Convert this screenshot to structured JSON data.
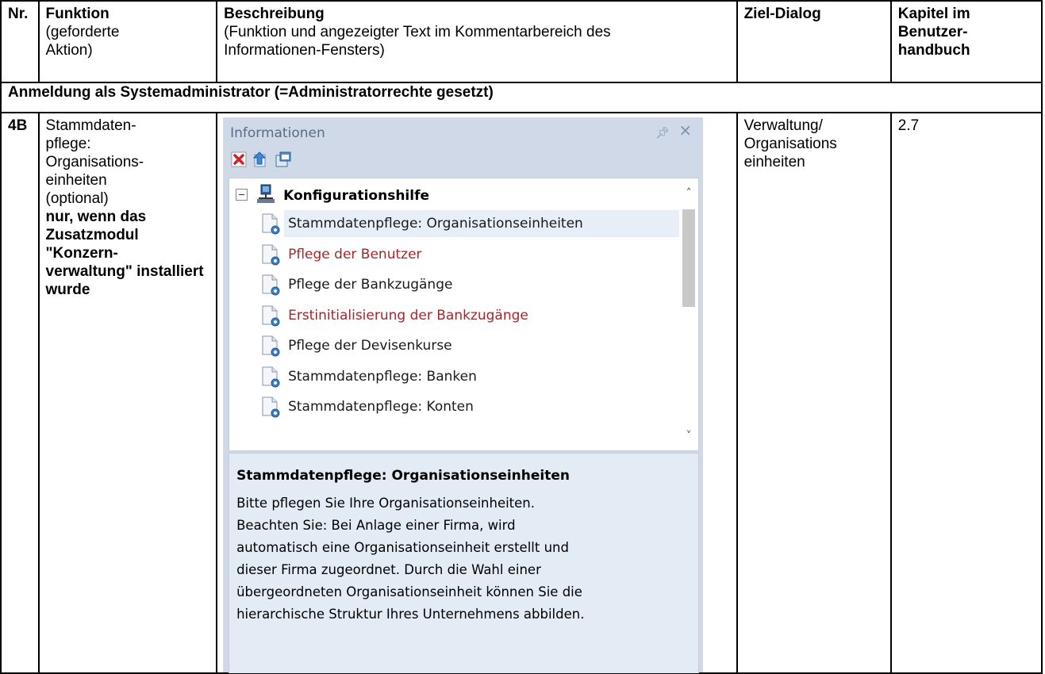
{
  "header": {
    "nr": "Nr.",
    "funktion_title": "Funktion",
    "funktion_sub": "(geforderte Aktion)",
    "beschreibung_title": "Beschreibung",
    "beschreibung_sub": "(Funktion und angezeigter Text im Kommentarbereich des Informationen-Fensters)",
    "ziel": "Ziel-Dialog",
    "kapitel": "Kapitel im Benutzer-handbuch"
  },
  "section": "Anmeldung als Systemadministrator (=Administratorrechte gesetzt)",
  "row": {
    "nr": "4B",
    "funktion_line1": "Stammdaten-",
    "funktion_line2": "pflege:",
    "funktion_line3": "Organisations-",
    "funktion_line4": "einheiten",
    "funktion_line5": "(optional)",
    "funktion_bold": "nur, wenn das Zusatzmodul \"Konzern-verwaltung\" installiert wurde",
    "ziel": "Verwaltung/ Organisations einheiten",
    "kapitel": "2.7"
  },
  "panel": {
    "title": "Informationen",
    "root_label": "Konfigurationshilfe",
    "items": [
      {
        "label": "Stammdatenpflege: Organisationseinheiten",
        "status": "selected"
      },
      {
        "label": "Pflege der Benutzer",
        "status": "warn"
      },
      {
        "label": "Pflege der Bankzugänge",
        "status": "normal"
      },
      {
        "label": "Erstinitialisierung der Bankzugänge",
        "status": "warn"
      },
      {
        "label": "Pflege der Devisenkurse",
        "status": "normal"
      },
      {
        "label": "Stammdatenpflege: Banken",
        "status": "normal"
      },
      {
        "label": "Stammdatenpflege: Konten",
        "status": "normal"
      }
    ],
    "desc_title": "Stammdatenpflege: Organisationseinheiten",
    "desc_text": "Bitte pflegen Sie Ihre Organisationseinheiten.\n Beachten Sie: Bei Anlage einer Firma, wird\nautomatisch eine Organisationseinheit erstellt und\ndieser Firma zugeordnet. Durch die Wahl einer\nübergeordneten Organisationseinheit können Sie die\nhierarchische Struktur Ihres Unternehmens abbilden.",
    "colors": {
      "warn_text": "#a5262a",
      "panel_bg": "#cfd9e8",
      "selected_bg": "#e8eef7"
    }
  }
}
